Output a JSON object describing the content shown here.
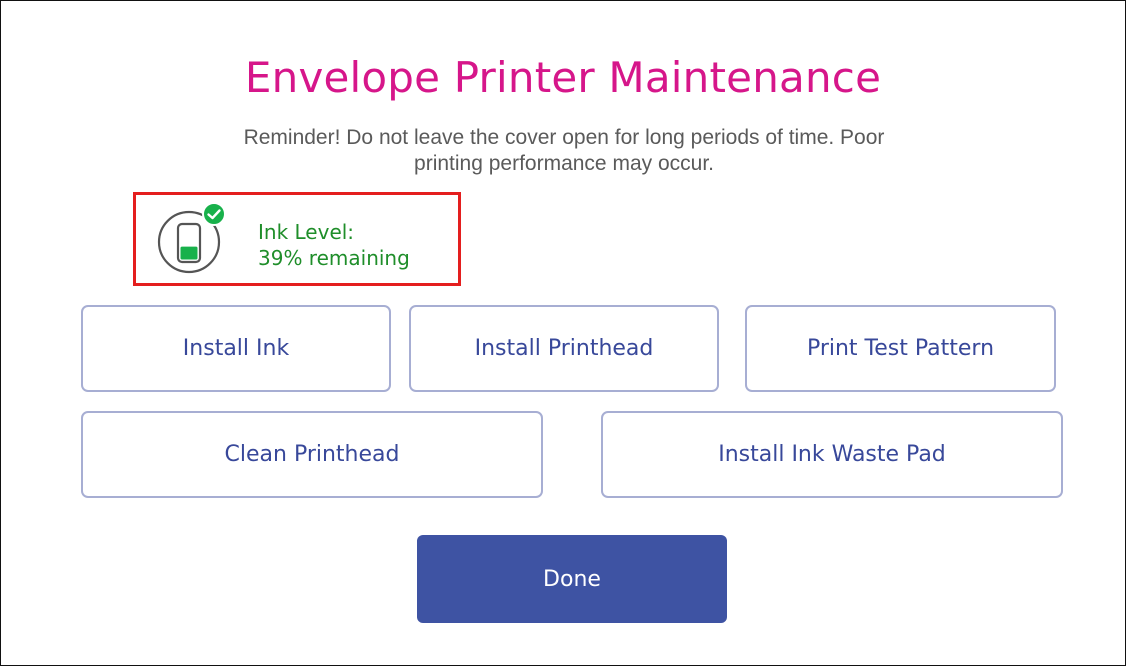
{
  "header": {
    "title": "Envelope Printer Maintenance",
    "reminder": "Reminder! Do not leave the cover open for long periods of time. Poor printing performance may occur."
  },
  "ink_status": {
    "label": "Ink Level:",
    "remaining_text": "39% remaining",
    "level_fraction": 0.39,
    "status_icon": "check-badge-icon",
    "icon": "ink-cartridge-icon",
    "color": "#1f8e2a"
  },
  "actions": {
    "install_ink": "Install Ink",
    "install_printhead": "Install Printhead",
    "print_test_pattern": "Print Test Pattern",
    "clean_printhead": "Clean Printhead",
    "install_ink_waste_pad": "Install Ink Waste Pad",
    "done": "Done"
  },
  "colors": {
    "title": "#d6168a",
    "button_text": "#38489a",
    "button_border": "#a7aed3",
    "primary": "#3e53a3",
    "highlight": "#e41e1e"
  }
}
